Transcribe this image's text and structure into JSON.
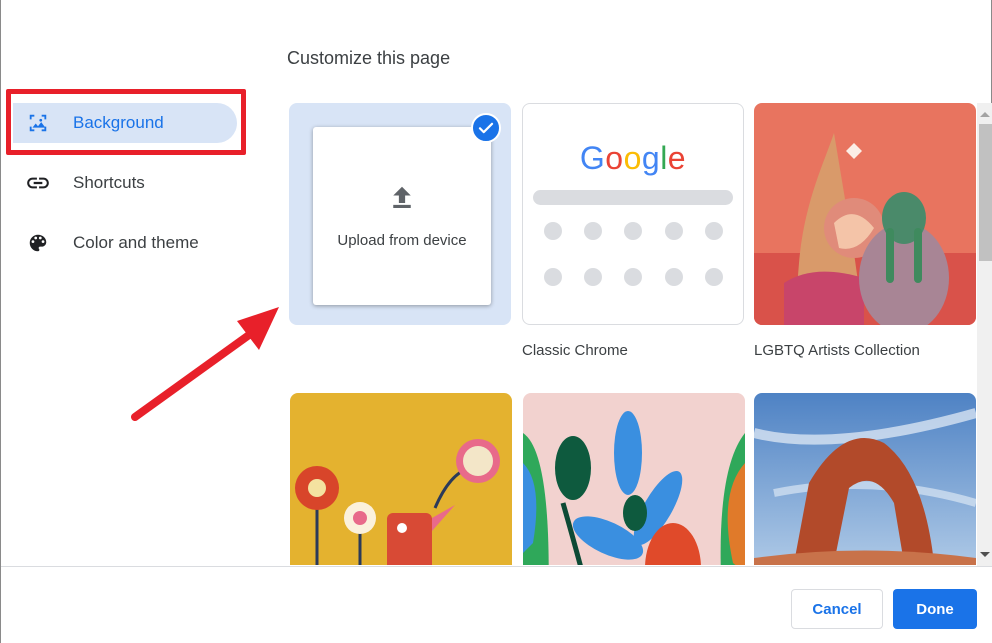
{
  "dialog": {
    "title": "Customize this page"
  },
  "sidebar": {
    "items": [
      {
        "label": "Background",
        "icon": "image-icon",
        "active": true
      },
      {
        "label": "Shortcuts",
        "icon": "link-icon",
        "active": false
      },
      {
        "label": "Color and theme",
        "icon": "palette-icon",
        "active": false
      }
    ]
  },
  "backgrounds": {
    "upload": {
      "label": "Upload from device",
      "selected": true
    },
    "tiles": [
      {
        "caption": "Classic Chrome",
        "google_text": "Google"
      },
      {
        "caption": "LGBTQ Artists Collection"
      },
      {
        "caption": ""
      },
      {
        "caption": ""
      },
      {
        "caption": ""
      }
    ]
  },
  "footer": {
    "cancel_label": "Cancel",
    "done_label": "Done"
  },
  "colors": {
    "accent": "#1a73e8",
    "selected_bg": "#d8e4f6",
    "annotation": "#e8202a"
  }
}
